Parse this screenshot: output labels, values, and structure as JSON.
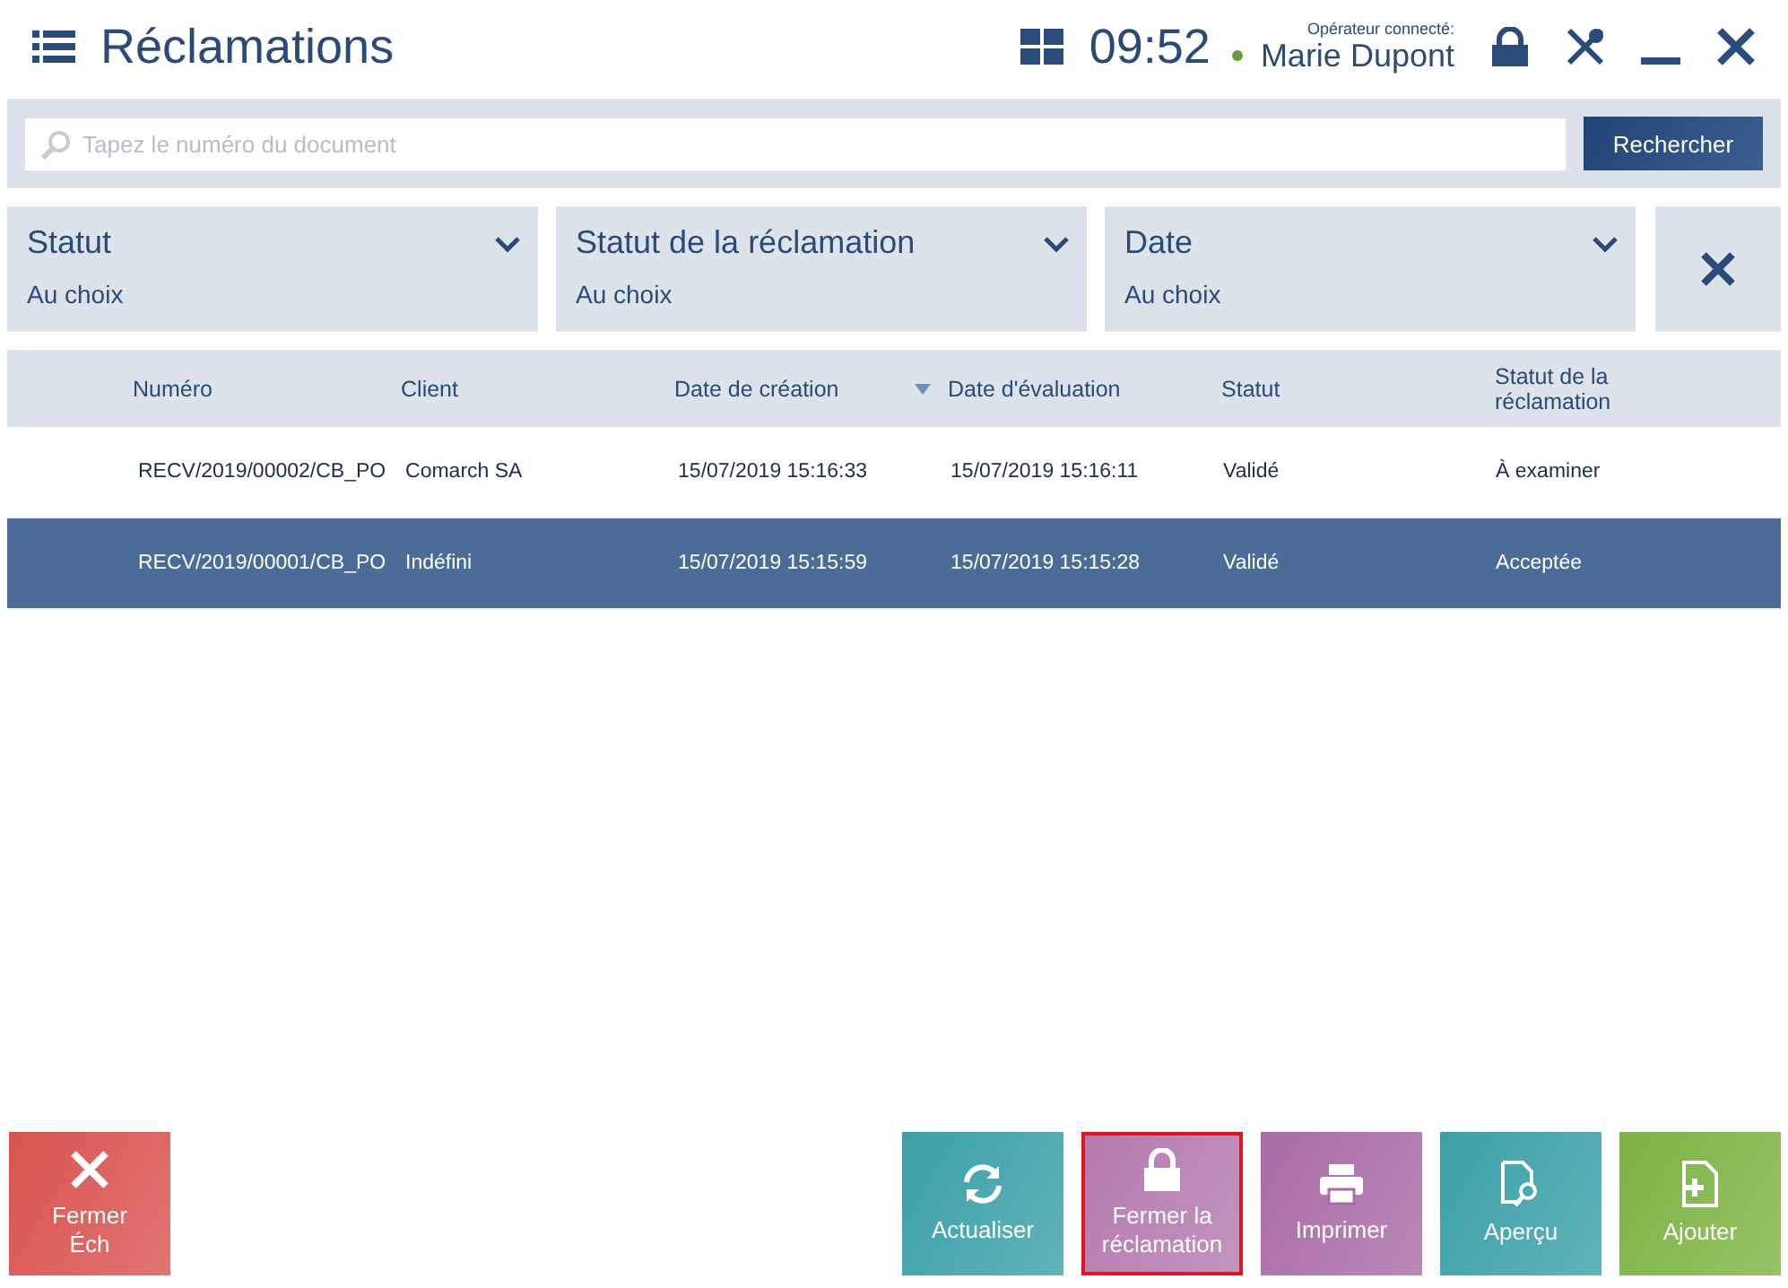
{
  "header": {
    "title": "Réclamations",
    "time": "09:52",
    "operator_label": "Opérateur connecté:",
    "operator": "Marie Dupont",
    "online": true
  },
  "search": {
    "placeholder": "Tapez le numéro du document",
    "button": "Rechercher"
  },
  "filters": [
    {
      "label": "Statut",
      "value": "Au choix"
    },
    {
      "label": "Statut de la réclamation",
      "value": "Au choix"
    },
    {
      "label": "Date",
      "value": "Au choix"
    }
  ],
  "table": {
    "columns": [
      {
        "label": "Numéro",
        "sorted": false
      },
      {
        "label": "Client",
        "sorted": false
      },
      {
        "label": "Date de création",
        "sorted": true
      },
      {
        "label": "Date d'évaluation",
        "sorted": false
      },
      {
        "label": "Statut",
        "sorted": false
      },
      {
        "label": "Statut de la réclamation",
        "sorted": false
      }
    ],
    "rows": [
      {
        "cells": [
          "RECV/2019/00002/CB_PO",
          "Comarch SA",
          "15/07/2019 15:16:33",
          "15/07/2019 15:16:11",
          "Validé",
          "À examiner"
        ],
        "selected": false
      },
      {
        "cells": [
          "RECV/2019/00001/CB_PO",
          "Indéfini",
          "15/07/2019 15:15:59",
          "15/07/2019 15:15:28",
          "Validé",
          "Acceptée"
        ],
        "selected": true
      }
    ]
  },
  "actions_left": [
    {
      "label": "Fermer Éch",
      "kind": "close",
      "color": "#d9534f",
      "focused": false
    }
  ],
  "actions_right": [
    {
      "label": "Actualiser",
      "kind": "refresh",
      "color": "#3aa0a8",
      "focused": false
    },
    {
      "label": "Fermer la réclamation",
      "kind": "lock",
      "color": "#b47aaf",
      "focused": true
    },
    {
      "label": "Imprimer",
      "kind": "print",
      "color": "#a96ba6",
      "focused": false
    },
    {
      "label": "Aperçu",
      "kind": "preview",
      "color": "#3aa0a8",
      "focused": false
    },
    {
      "label": "Ajouter",
      "kind": "add",
      "color": "#7cb342",
      "focused": false
    }
  ]
}
